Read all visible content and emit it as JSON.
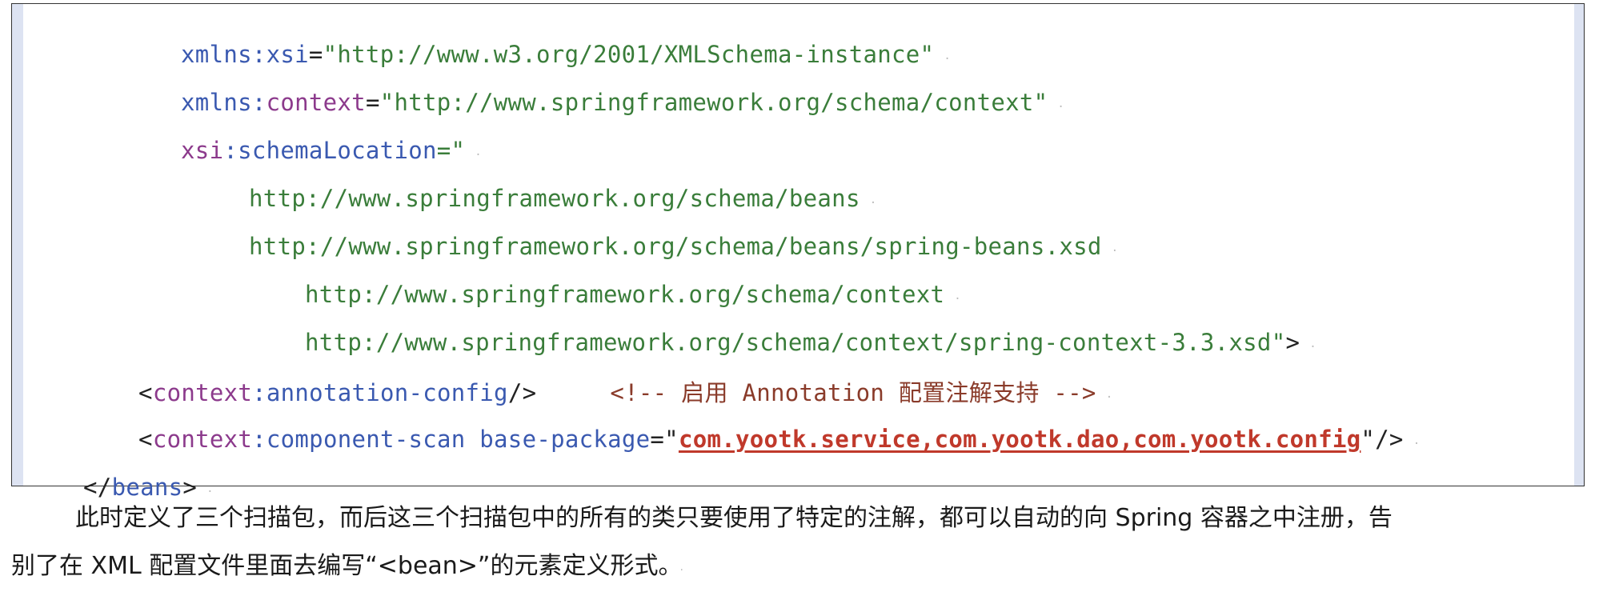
{
  "code": {
    "line1": {
      "attr": "xmlns:xsi",
      "eq": "=",
      "value": "\"http://www.w3.org/2001/XMLSchema-instance\""
    },
    "line2": {
      "attr_ns": "xmlns:",
      "attr_local": "context",
      "eq": "=",
      "value": "\"http://www.springframework.org/schema/context\""
    },
    "line3": {
      "attr_ns": "xsi",
      "attr_local": ":schemaLocation",
      "value": "=\""
    },
    "line4": "http://www.springframework.org/schema/beans",
    "line5": "http://www.springframework.org/schema/beans/spring-beans.xsd",
    "line6": "http://www.springframework.org/schema/context",
    "line7": {
      "value": "http://www.springframework.org/schema/context/spring-context-3.3.xsd\"",
      "close": ">"
    },
    "line8": {
      "open": "<",
      "ns": "context",
      "local": ":annotation-config",
      "close": "/>",
      "comment": "<!-- 启用 Annotation 配置注解支持 -->"
    },
    "line9": {
      "open": "<",
      "ns": "context",
      "local": ":component-scan base-package",
      "eq": "=",
      "quote_open": "\"",
      "packages": "com.yootk.service,com.yootk.dao,com.yootk.config",
      "quote_close": "\"",
      "close": "/>"
    },
    "line10": {
      "open": "</",
      "tag": "beans",
      "close": ">"
    }
  },
  "prose": {
    "line1": "此时定义了三个扫描包，而后这三个扫描包中的所有的类只要使用了特定的注解，都可以自动的向 Spring 容器之中注册，告",
    "line2": "别了在 XML 配置文件里面去编写“<bean>”的元素定义形式。"
  }
}
